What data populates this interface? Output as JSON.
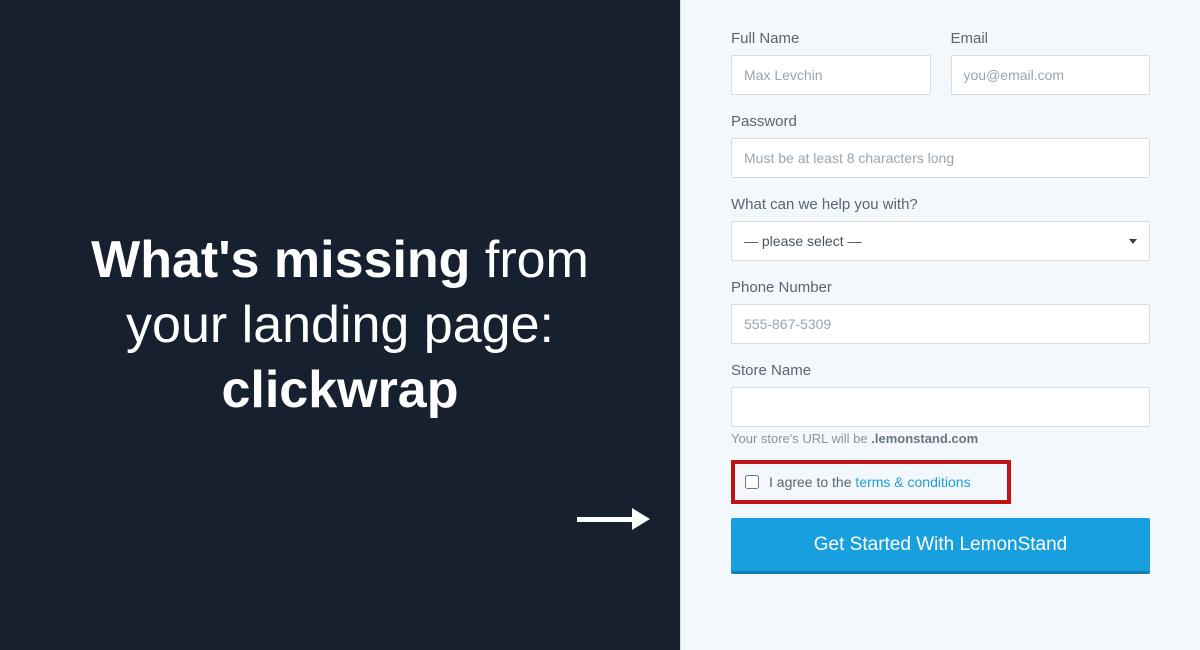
{
  "headline": {
    "part1_bold": "What's missing",
    "part1_rest": " from",
    "line2": "your landing page:",
    "line3_bold": "clickwrap"
  },
  "form": {
    "fullName": {
      "label": "Full Name",
      "placeholder": "Max Levchin"
    },
    "email": {
      "label": "Email",
      "placeholder": "you@email.com"
    },
    "password": {
      "label": "Password",
      "placeholder": "Must be at least 8 characters long"
    },
    "help": {
      "label": "What can we help you with?",
      "selected": "— please select —"
    },
    "phone": {
      "label": "Phone Number",
      "placeholder": "555-867-5309"
    },
    "storeName": {
      "label": "Store Name"
    },
    "urlHint": {
      "prefix": "Your store's URL will be ",
      "domain": ".lemonstand.com"
    },
    "agree": {
      "prefix": "I agree to the ",
      "link": "terms & conditions"
    },
    "submit": "Get Started With LemonStand"
  }
}
